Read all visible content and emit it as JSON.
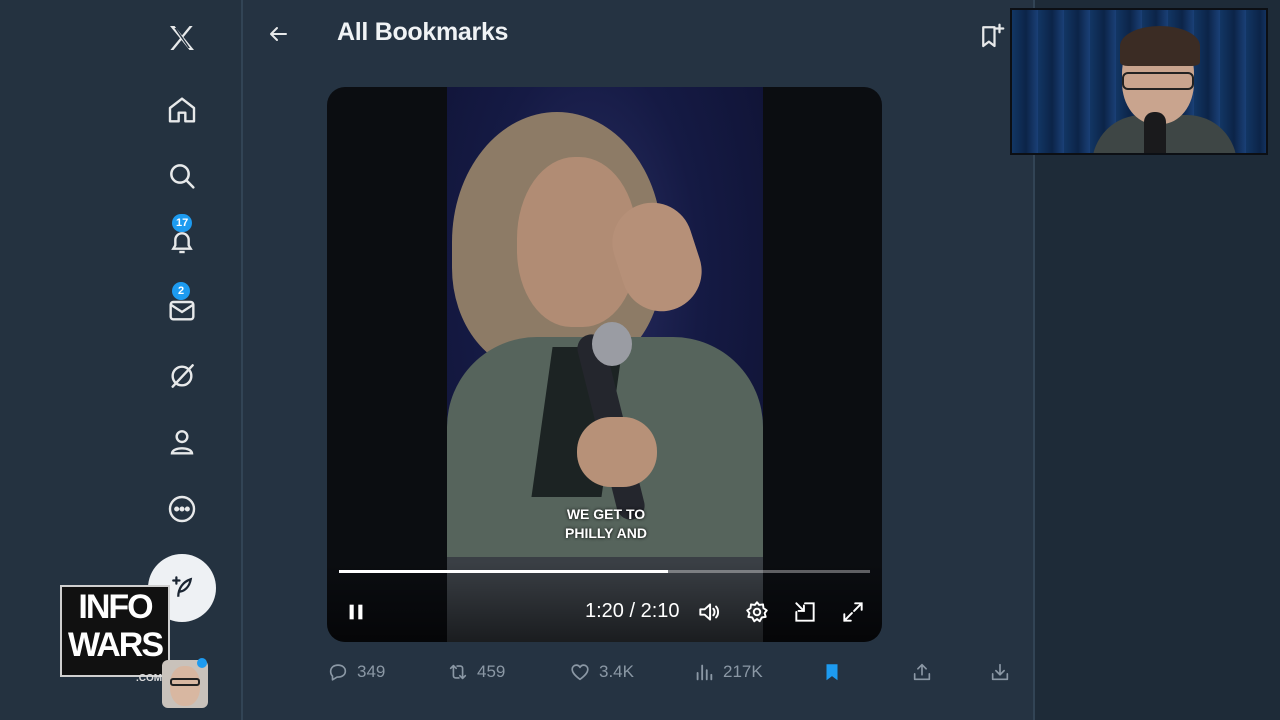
{
  "header": {
    "title": "All Bookmarks"
  },
  "nav": {
    "notifications_badge": "17",
    "messages_badge": "2"
  },
  "video": {
    "caption_line1": "WE GET TO",
    "caption_line2": "PHILLY AND",
    "time": "1:20 / 2:10",
    "progress": 0.62
  },
  "actions": {
    "replies": "349",
    "reposts": "459",
    "likes": "3.4K",
    "views": "217K"
  },
  "overlay": {
    "logo_line1": "INFO",
    "logo_line2": "WARS",
    "logo_suffix": ".COM"
  },
  "colors": {
    "accent": "#1d9bf0",
    "background": "#253342",
    "sidebar": "#243240"
  },
  "icons": {
    "nav": [
      "x-logo-icon",
      "home-icon",
      "search-icon",
      "bell-icon",
      "mail-icon",
      "grok-icon",
      "profile-icon",
      "more-icon"
    ],
    "video_controls": [
      "pause-icon",
      "volume-icon",
      "settings-icon",
      "pip-icon",
      "fullscreen-icon"
    ],
    "actions": [
      "reply-icon",
      "repost-icon",
      "like-icon",
      "views-icon",
      "bookmark-icon",
      "share-icon",
      "download-icon"
    ]
  }
}
